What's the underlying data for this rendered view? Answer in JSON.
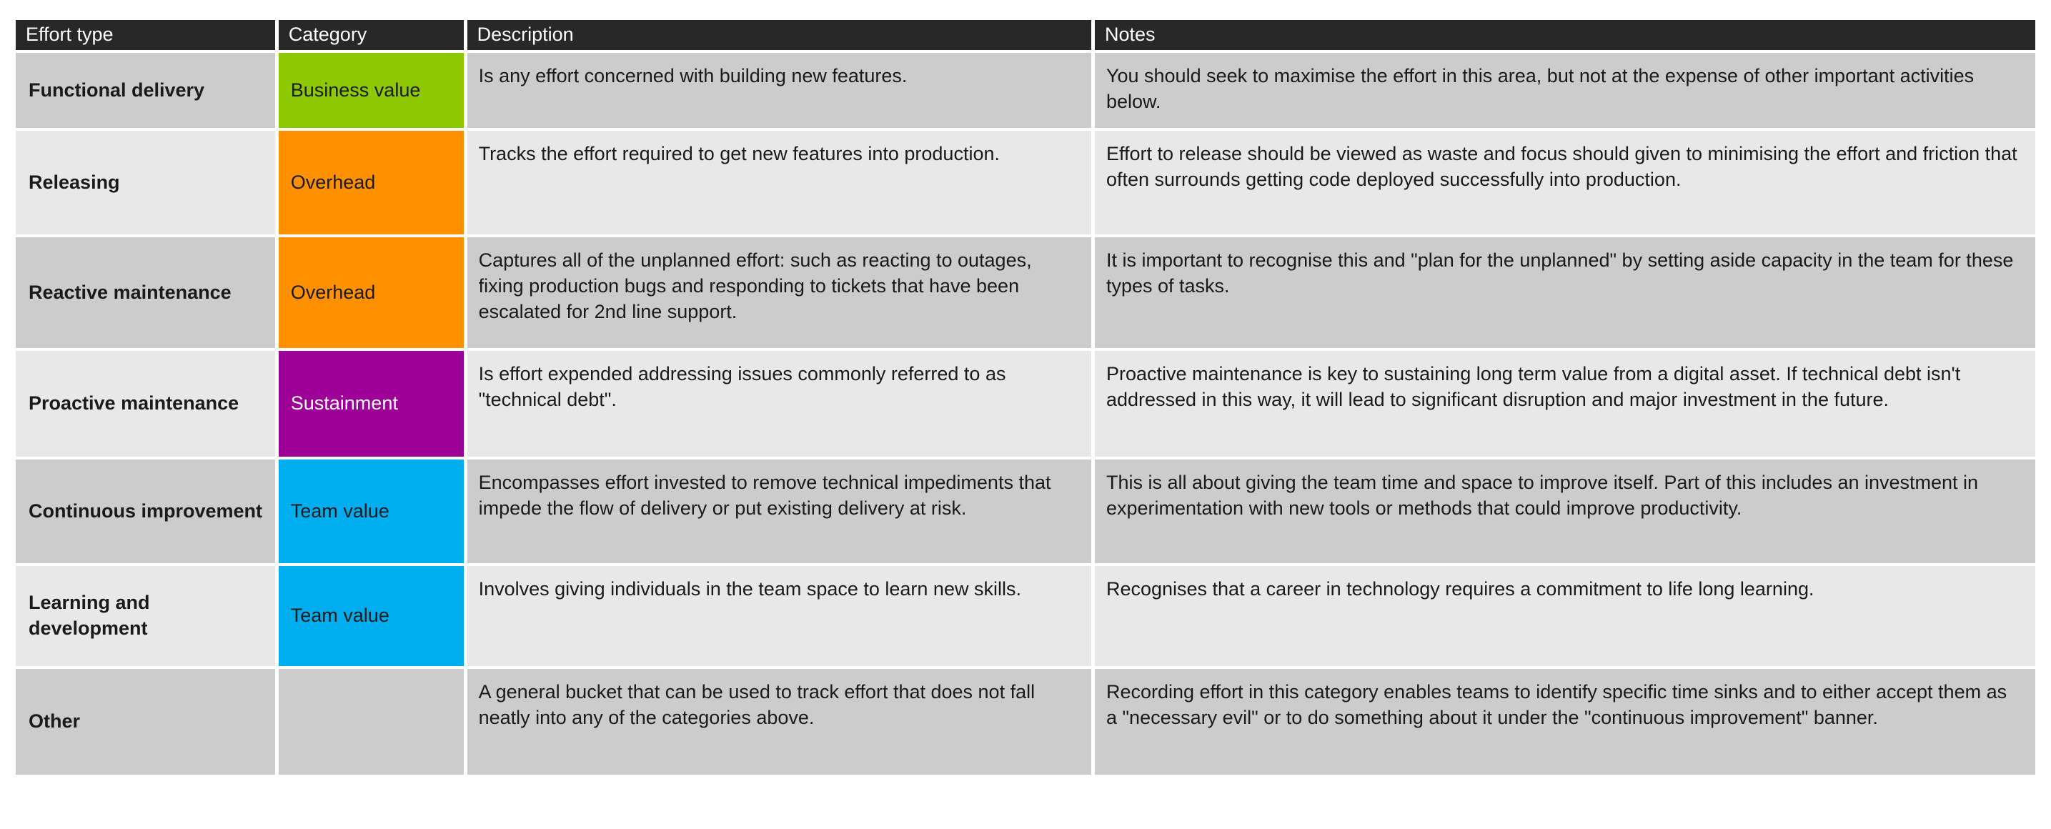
{
  "table": {
    "columns": [
      {
        "key": "effort_type",
        "label": "Effort type"
      },
      {
        "key": "category",
        "label": "Category"
      },
      {
        "key": "description",
        "label": "Description"
      },
      {
        "key": "notes",
        "label": "Notes"
      }
    ],
    "header_bg": "#282828",
    "header_fg": "#ffffff",
    "row_shades": [
      "#cccccc",
      "#e8e8e8"
    ],
    "category_colors": {
      "Business value": "#8DC800",
      "Overhead": "#FF9100",
      "Sustainment": "#9C0096",
      "Team value": "#00AEEF",
      "none": ""
    },
    "rows": [
      {
        "effort_type": "Functional delivery",
        "category": "Business value",
        "category_color": "#8DC800",
        "description": "Is any effort concerned with building new features.",
        "notes": "You should seek to maximise the effort in this area, but not at the expense of other important activities below."
      },
      {
        "effort_type": "Releasing",
        "category": "Overhead",
        "category_color": "#FF9100",
        "description": "Tracks the effort required to get new features into production.",
        "notes": "Effort to release should be viewed as waste and focus should given to minimising the effort and friction that often surrounds getting code deployed successfully into production."
      },
      {
        "effort_type": "Reactive maintenance",
        "category": "Overhead",
        "category_color": "#FF9100",
        "description": "Captures all of the unplanned effort: such as reacting to outages, fixing production bugs and responding to tickets that have been escalated for 2nd line support.",
        "notes": "It is important to recognise this and \"plan for the unplanned\" by setting aside capacity in the team for these types of tasks."
      },
      {
        "effort_type": "Proactive maintenance",
        "category": "Sustainment",
        "category_color": "#9C0096",
        "description": "Is effort expended addressing issues commonly referred to as \"technical debt\".",
        "notes": "Proactive maintenance is key to sustaining long term value from a digital asset.  If technical debt isn't addressed in this way, it will lead to significant disruption and major investment in the future."
      },
      {
        "effort_type": "Continuous improvement",
        "category": "Team value",
        "category_color": "#00AEEF",
        "description": "Encompasses effort invested to remove technical impediments that impede the flow of delivery or put existing delivery at risk.",
        "notes": "This is all about giving the team time and space to improve itself.  Part of this includes an investment in experimentation with new tools or methods that could improve productivity."
      },
      {
        "effort_type": "Learning and development",
        "category": "Team value",
        "category_color": "#00AEEF",
        "description": "Involves giving individuals in the team space to learn new skills.",
        "notes": "Recognises that a career in technology requires a commitment to life long learning."
      },
      {
        "effort_type": "Other",
        "category": "",
        "category_color": "",
        "description": "A general bucket that can be used to track effort that does not fall neatly into any of the categories above.",
        "notes": "Recording effort in this category enables teams to identify specific time sinks and to either accept them as a \"necessary evil\" or to do something about it under the \"continuous improvement\" banner."
      }
    ]
  }
}
